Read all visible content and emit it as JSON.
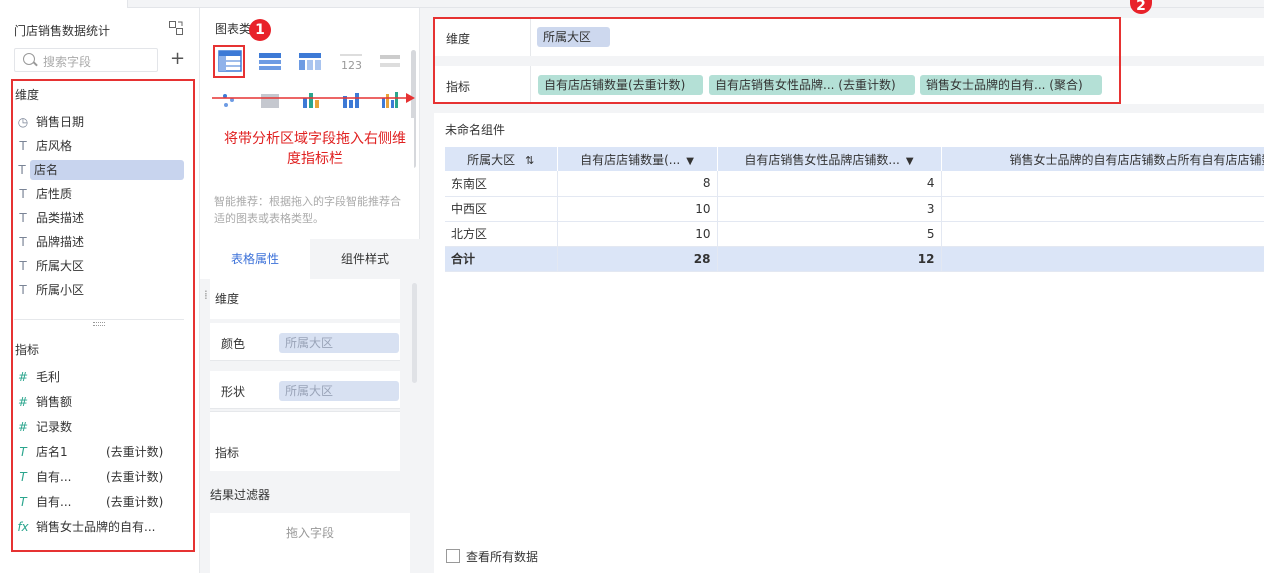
{
  "left": {
    "title": "门店销售数据统计",
    "search_placeholder": "搜索字段",
    "dimension_label": "维度",
    "dimension_fields": [
      {
        "icon": "clock-icon",
        "glyph": "◷",
        "label": "销售日期"
      },
      {
        "icon": "text-icon",
        "glyph": "T",
        "label": "店风格"
      },
      {
        "icon": "text-icon",
        "glyph": "T",
        "label": "店名"
      },
      {
        "icon": "text-icon",
        "glyph": "T",
        "label": "店性质"
      },
      {
        "icon": "text-icon",
        "glyph": "T",
        "label": "品类描述"
      },
      {
        "icon": "text-icon",
        "glyph": "T",
        "label": "品牌描述"
      },
      {
        "icon": "text-icon",
        "glyph": "T",
        "label": "所属大区"
      },
      {
        "icon": "text-icon",
        "glyph": "T",
        "label": "所属小区"
      }
    ],
    "measure_label": "指标",
    "measure_fields": [
      {
        "icon": "number-icon",
        "glyph": "#",
        "label": "毛利"
      },
      {
        "icon": "number-icon",
        "glyph": "#",
        "label": "销售额"
      },
      {
        "icon": "count-icon",
        "glyph": "#",
        "label": "记录数"
      },
      {
        "icon": "distinct-text-icon",
        "glyph": "T",
        "label": "店名1",
        "suffix": "(去重计数)"
      },
      {
        "icon": "distinct-text-icon",
        "glyph": "T",
        "label": "自有...",
        "suffix": "(去重计数)"
      },
      {
        "icon": "distinct-text-icon",
        "glyph": "T",
        "label": "自有...",
        "suffix": "(去重计数)"
      },
      {
        "icon": "formula-icon",
        "glyph": "fx",
        "label": "销售女士品牌的自有..."
      }
    ]
  },
  "mid": {
    "chart_type_label": "图表类",
    "annotation": "将带分析区域字段拖入右侧维度指标栏",
    "smart_hint": "智能推荐：根据拖入的字段智能推荐合适的图表或表格类型。",
    "tabs": [
      "表格属性",
      "组件样式"
    ],
    "dimension_label": "维度",
    "color_label": "颜色",
    "color_value": "所属大区",
    "shape_label": "形状",
    "shape_value": "所属大区",
    "measure_label": "指标",
    "filter_label": "结果过滤器",
    "drop_hint": "拖入字段"
  },
  "right": {
    "dimension_shelf_label": "维度",
    "dimension_pills": [
      "所属大区"
    ],
    "measure_shelf_label": "指标",
    "measure_pills": [
      "自有店店铺数量(去重计数)",
      "自有店销售女性品牌... (去重计数)",
      "销售女士品牌的自有... (聚合)"
    ],
    "component_name": "未命名组件",
    "table": {
      "headers": [
        "所属大区",
        "自有店店铺数量(...",
        "自有店销售女性品牌店铺数...",
        "销售女士品牌的自有店店铺数占所有自有店店铺数"
      ],
      "rows": [
        {
          "region": "东南区",
          "a": "8",
          "b": "4",
          "c": ""
        },
        {
          "region": "中西区",
          "a": "10",
          "b": "3",
          "c": ""
        },
        {
          "region": "北方区",
          "a": "10",
          "b": "5",
          "c": ""
        }
      ],
      "total": {
        "region": "合计",
        "a": "28",
        "b": "12",
        "c": ""
      }
    },
    "view_all_label": "查看所有数据"
  },
  "badges": [
    "1",
    "2"
  ],
  "colors": {
    "accent": "#3d72d9",
    "annotation_red": "#e63232",
    "dim_pill": "#cdd8ee",
    "measure_pill": "#b4e0d6",
    "header_bg": "#dbe5f7"
  }
}
